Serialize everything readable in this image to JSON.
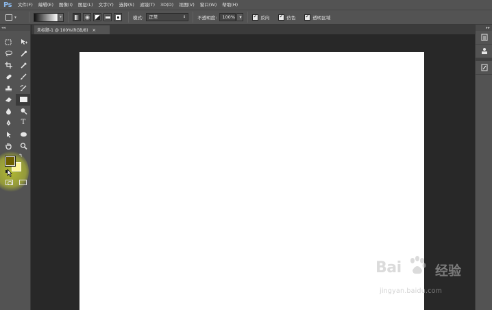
{
  "app": {
    "logo": "Ps"
  },
  "menu": [
    "文件(F)",
    "编辑(E)",
    "图像(I)",
    "图层(L)",
    "文字(Y)",
    "选择(S)",
    "滤镜(T)",
    "3D(D)",
    "视图(V)",
    "窗口(W)",
    "帮助(H)"
  ],
  "options": {
    "mode_label": "模式:",
    "mode_value": "正常",
    "opacity_label": "不透明度:",
    "opacity_value": "100%",
    "reverse_label": "反向",
    "dither_label": "仿色",
    "transparency_label": "透明区域"
  },
  "document": {
    "tab_title": "未标题-1 @ 100%(RGB/8)",
    "close_glyph": "×"
  },
  "colors": {
    "foreground": "#6e5f00",
    "background": "#fff59a"
  },
  "watermark": {
    "logo": "Bai",
    "logo_tail": "经验",
    "url": "jingyan.baidu.com"
  }
}
